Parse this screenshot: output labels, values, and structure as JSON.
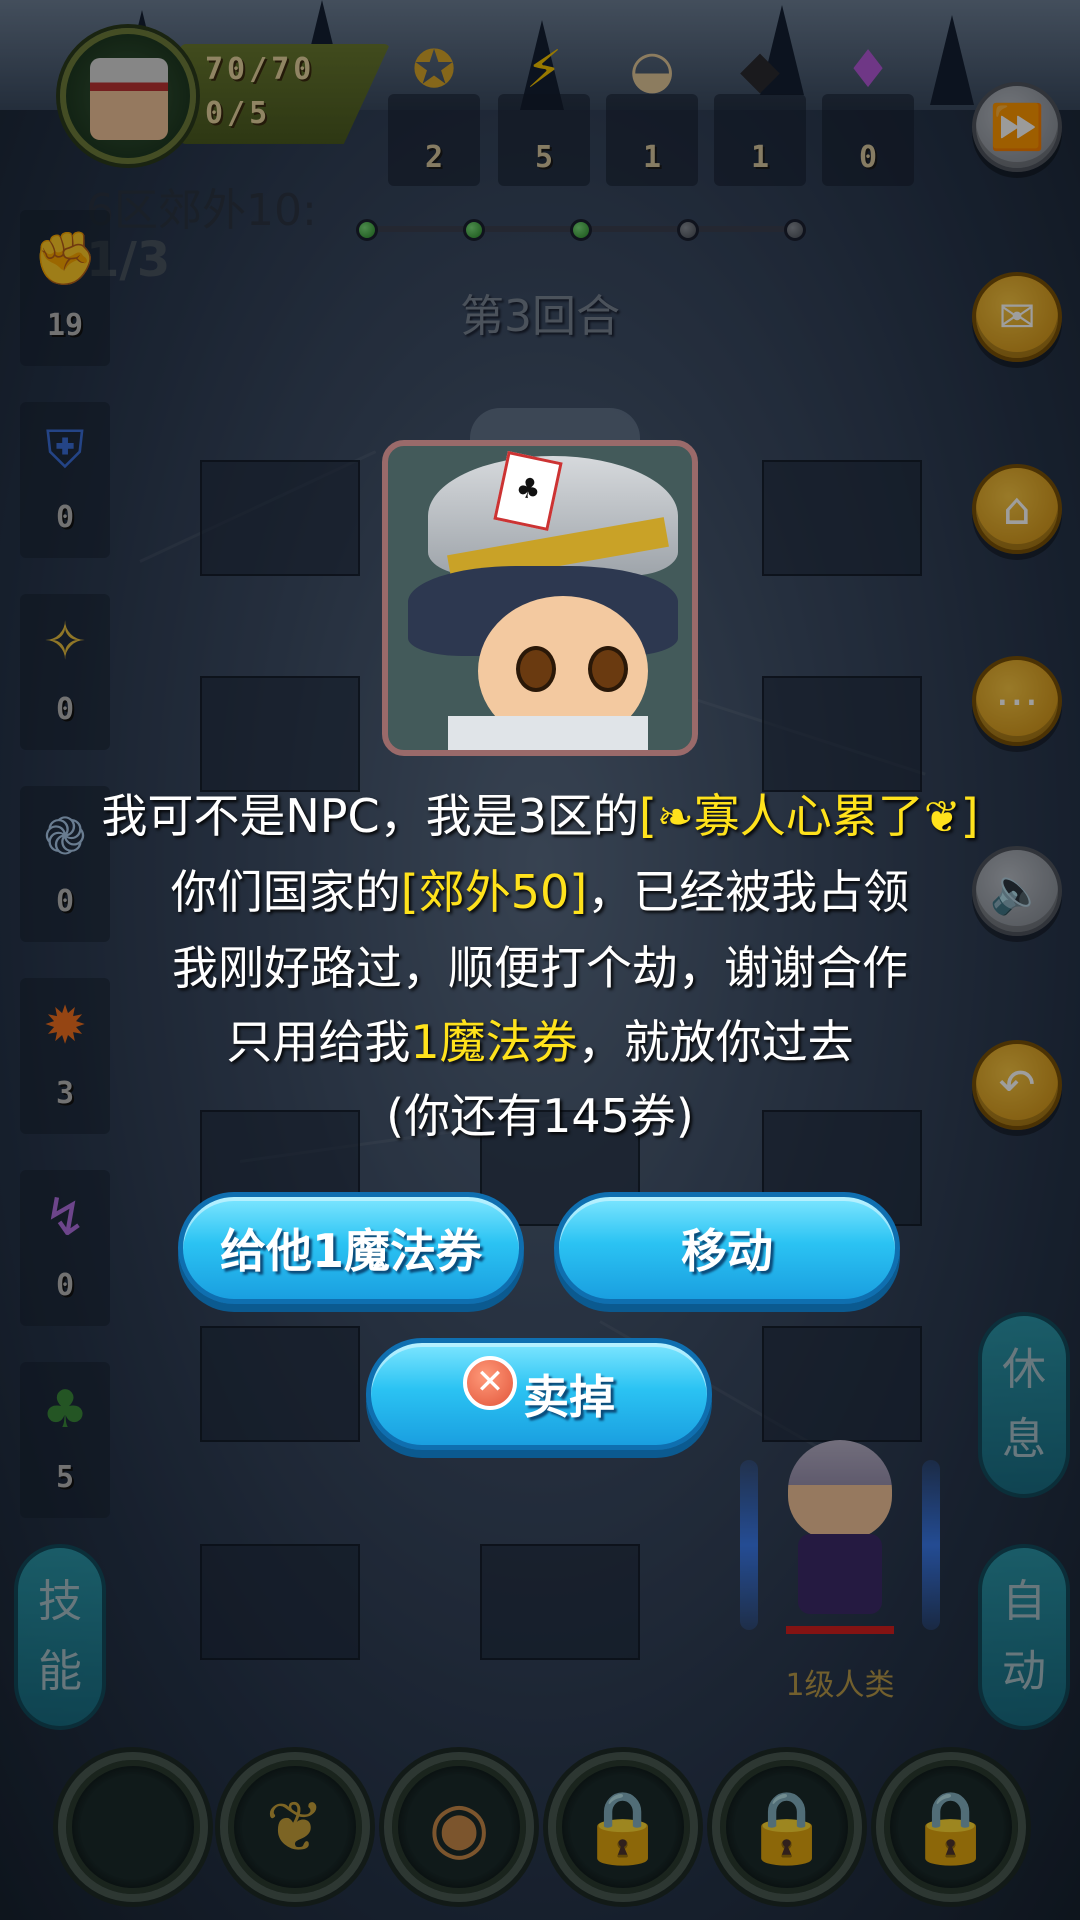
{
  "header": {
    "hp": "70/70",
    "energy": "0/5",
    "resources": [
      {
        "icon": "star-coin-icon",
        "glyph": "✪",
        "count": "2",
        "color": "#d9a62a"
      },
      {
        "icon": "lightning-icon",
        "glyph": "⚡",
        "count": "5",
        "color": "#f5c400"
      },
      {
        "icon": "dumpling-icon",
        "glyph": "◒",
        "count": "1",
        "color": "#e3c89a"
      },
      {
        "icon": "iron-ore-icon",
        "glyph": "◆",
        "count": "1",
        "color": "#2a2a30"
      },
      {
        "icon": "crystal-icon",
        "glyph": "♦",
        "count": "0",
        "color": "#b45ad8"
      }
    ]
  },
  "stage": {
    "title": "6区郊外10:",
    "progress": "1/3",
    "round": "第3回合",
    "checkpoints_total": 5,
    "checkpoints_done": 3
  },
  "stats": [
    {
      "icon": "fist-icon",
      "glyph": "✊",
      "value": "19",
      "color": "#b5652e"
    },
    {
      "icon": "shield-icon",
      "glyph": "⛨",
      "value": "0",
      "color": "#3a6fd8"
    },
    {
      "icon": "holy-flame-icon",
      "glyph": "✧",
      "value": "0",
      "color": "#e8c040"
    },
    {
      "icon": "wind-swirl-icon",
      "glyph": "֎",
      "value": "0",
      "color": "#aac8e8"
    },
    {
      "icon": "fire-icon",
      "glyph": "✹",
      "value": "3",
      "color": "#f07020"
    },
    {
      "icon": "lightning-rune-icon",
      "glyph": "↯",
      "value": "0",
      "color": "#b070e0"
    },
    {
      "icon": "poison-icon",
      "glyph": "♣",
      "value": "5",
      "color": "#3a8a3a"
    }
  ],
  "side_buttons": {
    "rest": [
      "休",
      "息"
    ],
    "auto": [
      "自",
      "动"
    ],
    "skill": [
      "技",
      "能"
    ]
  },
  "player": {
    "label": "1级人类"
  },
  "dialog": {
    "line1_pre": "我可不是NPC，我是3区的",
    "line1_name": "[",
    "line1_deco_left": "❧",
    "line1_player": "寡人心累了",
    "line1_deco_right": "❦",
    "line1_close": "]",
    "line2_pre": "你们国家的",
    "line2_place": "[郊外50]",
    "line2_post": "，已经被我占领",
    "line3": "我刚好路过，顺便打个劫，谢谢合作",
    "line4_pre": "只用给我",
    "line4_price": "1魔法券",
    "line4_post": "，就放你过去",
    "line5": "(你还有145券)"
  },
  "buttons": {
    "pay": "给他1魔法券",
    "move": "移动",
    "sell": "卖掉"
  }
}
